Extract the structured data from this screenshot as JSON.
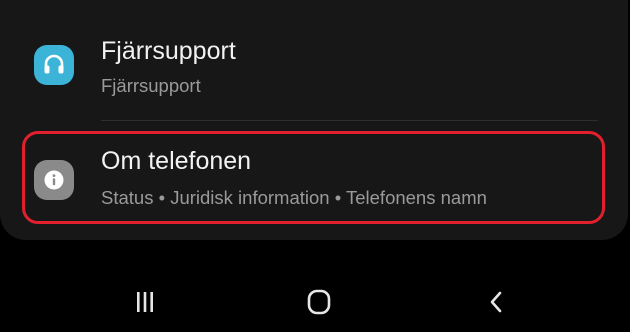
{
  "settings": {
    "items": [
      {
        "title": "Fjärrsupport",
        "subtitle": "Fjärrsupport",
        "icon": "headset-icon",
        "icon_color": "#3cb4d8"
      },
      {
        "title": "Om telefonen",
        "subtitle": "Status  •  Juridisk information  •  Telefonens namn",
        "icon": "info-icon",
        "icon_color": "#8a8a8a"
      }
    ],
    "highlight_color": "#e2202d"
  },
  "navbar": {
    "buttons": [
      "recents-icon",
      "home-icon",
      "back-icon"
    ]
  }
}
